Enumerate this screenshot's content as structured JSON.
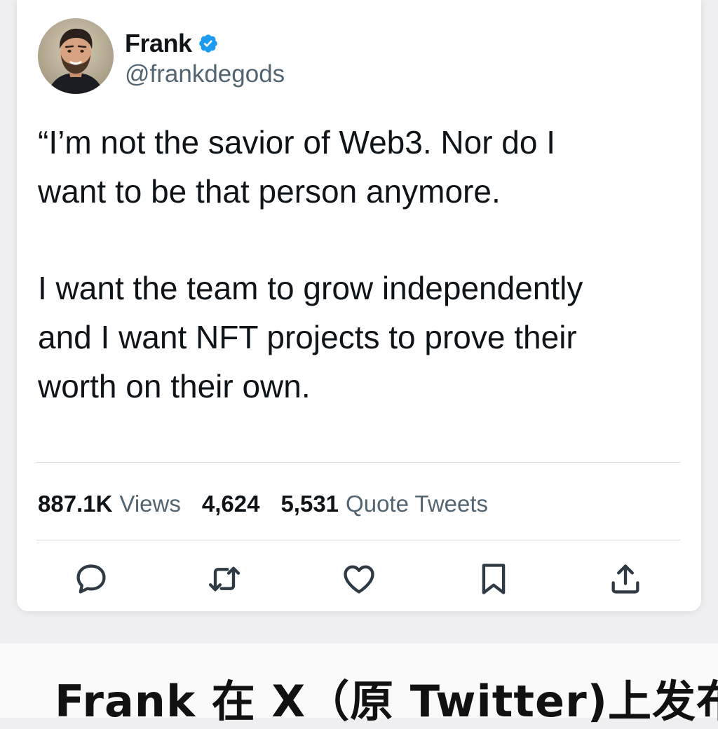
{
  "tweet": {
    "author": {
      "display_name": "Frank",
      "handle": "@frankdegods",
      "verified": true,
      "verified_icon": "verified-badge-icon",
      "avatar": "avatar-photo"
    },
    "text_paragraphs": [
      [
        "“I’m not the savior of Web3. Nor do I",
        "want to be that person anymore."
      ],
      [
        "I want the team to grow independently",
        "and I want NFT projects to prove their",
        "worth on their own."
      ]
    ],
    "stats": {
      "views_count": "887.1K",
      "views_label": "Views",
      "retweets_count": "4,624",
      "quotes_count": "5,531",
      "quotes_label": "Quote Tweets"
    },
    "actions": [
      {
        "name": "reply-button",
        "icon": "reply-icon"
      },
      {
        "name": "retweet-button",
        "icon": "retweet-icon"
      },
      {
        "name": "like-button",
        "icon": "heart-icon"
      },
      {
        "name": "bookmark-button",
        "icon": "bookmark-icon"
      },
      {
        "name": "share-button",
        "icon": "share-icon"
      }
    ]
  },
  "caption": "Frank 在 X（原 Twitter)上发布",
  "colors": {
    "text_primary": "#0f1419",
    "text_secondary": "#536471",
    "verified_blue": "#1d9bf0",
    "divider": "#cfd9de",
    "background": "#efeff2"
  }
}
